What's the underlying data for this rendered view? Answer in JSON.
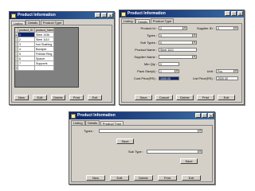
{
  "win1": {
    "title": "Product Information",
    "tabs": [
      "Listing",
      "Details",
      "Product Type"
    ],
    "grid": {
      "headers": [
        "product_ID",
        "product_Name"
      ],
      "rows": [
        {
          "id": "1",
          "name": "Steel 1036"
        },
        {
          "id": "2",
          "name": "Steel 1110"
        },
        {
          "id": "3",
          "name": "Iron Bushing"
        },
        {
          "id": "4",
          "name": "Bondper"
        },
        {
          "id": "5",
          "name": "Polistar Ring"
        },
        {
          "id": "6",
          "name": "Spacer"
        },
        {
          "id": "7",
          "name": "Supports"
        },
        {
          "id": "",
          "name": ""
        }
      ]
    },
    "buttons": [
      "New",
      "Edit",
      "Delete",
      "Print",
      "Exit"
    ]
  },
  "win2": {
    "title": "Product Information",
    "tabs": [
      "Listing",
      "Details",
      "Product Type"
    ],
    "fields": {
      "product_id_label": "Product Id :",
      "product_id": "2",
      "supplier_id_label": "Supplier ID :",
      "supplier_id": "0",
      "types_label": "Types :",
      "types": "0",
      "sub_types_label": "Sub Types :",
      "sub_types": "0",
      "product_name_label": "Product Name :",
      "product_name": "Steel 1110",
      "supplier_name_label": "Supplier Name :",
      "supplier_name": "",
      "min_qty_label": "Min Qty :",
      "min_qty": "0",
      "pack_size_label": "Pack Size(#) :",
      "pack_size": "1",
      "unit_label": "Unit :",
      "unit": "Pcs",
      "cost_price_label": "Cost Price(RS) :",
      "cost_price": "1000.00",
      "list_price_label": "List Price(RS) :",
      "list_price": "2000.00"
    },
    "buttons": [
      "Save",
      "Cancel",
      "Delete",
      "Print",
      "Exit"
    ]
  },
  "win3": {
    "title": "Product Information",
    "tabs": [
      "Listing",
      "Details",
      "Product Type"
    ],
    "types_label": "Types :",
    "types_value": "",
    "save1": "Save",
    "sub_type_label": "Sub Type :",
    "sub_type_value": "",
    "save2": "Save",
    "buttons": [
      "New",
      "Edit",
      "Delete",
      "Print",
      "Exit"
    ]
  }
}
